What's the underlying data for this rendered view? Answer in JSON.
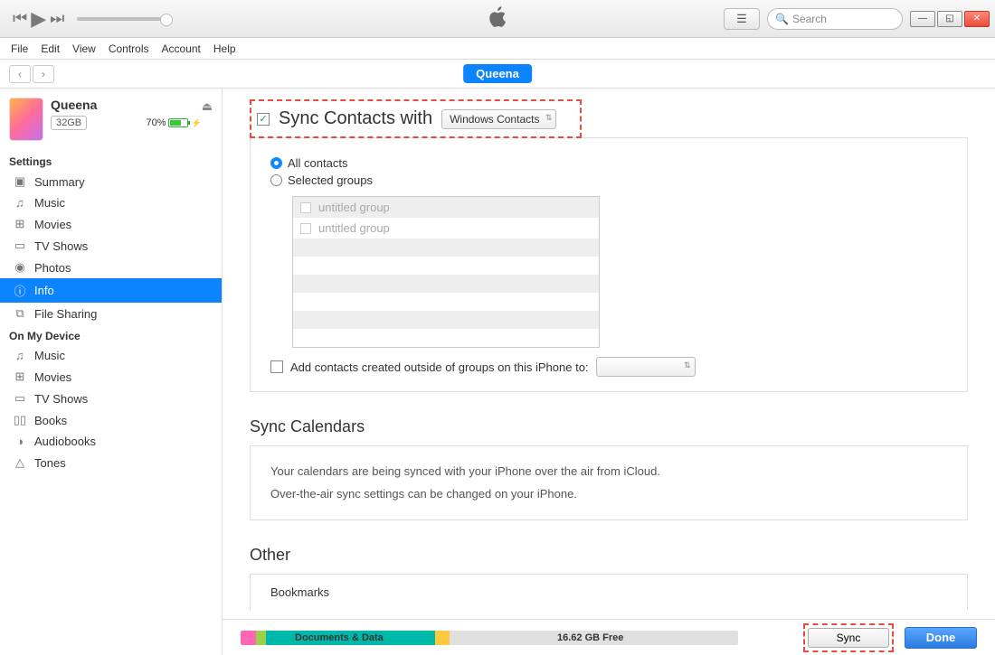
{
  "toolbar": {
    "search_placeholder": "Search"
  },
  "menubar": [
    "File",
    "Edit",
    "View",
    "Controls",
    "Account",
    "Help"
  ],
  "device_tab": "Queena",
  "device": {
    "name": "Queena",
    "capacity": "32GB",
    "battery_pct": "70%"
  },
  "sidebar": {
    "settings_title": "Settings",
    "settings_items": [
      {
        "icon": "▣",
        "label": "Summary"
      },
      {
        "icon": "♫",
        "label": "Music"
      },
      {
        "icon": "⊞",
        "label": "Movies"
      },
      {
        "icon": "▭",
        "label": "TV Shows"
      },
      {
        "icon": "◉",
        "label": "Photos"
      },
      {
        "icon": "ⓘ",
        "label": "Info"
      },
      {
        "icon": "⧉",
        "label": "File Sharing"
      }
    ],
    "ondevice_title": "On My Device",
    "ondevice_items": [
      {
        "icon": "♫",
        "label": "Music"
      },
      {
        "icon": "⊞",
        "label": "Movies"
      },
      {
        "icon": "▭",
        "label": "TV Shows"
      },
      {
        "icon": "▯▯",
        "label": "Books"
      },
      {
        "icon": "◑",
        "label": "Audiobooks"
      },
      {
        "icon": "△",
        "label": "Tones"
      }
    ]
  },
  "sync_contacts": {
    "title": "Sync Contacts with",
    "select_value": "Windows Contacts",
    "radio_all": "All contacts",
    "radio_selected": "Selected groups",
    "groups": [
      "untitled group",
      "untitled group"
    ],
    "add_label": "Add contacts created outside of groups on this iPhone to:"
  },
  "sync_calendars": {
    "title": "Sync Calendars",
    "line1": "Your calendars are being synced with your iPhone over the air from iCloud.",
    "line2": "Over-the-air sync settings can be changed on your iPhone."
  },
  "other": {
    "title": "Other",
    "item1": "Bookmarks"
  },
  "bottom": {
    "storage_label": "Documents & Data",
    "free_label": "16.62 GB Free",
    "sync_btn": "Sync",
    "done_btn": "Done"
  }
}
